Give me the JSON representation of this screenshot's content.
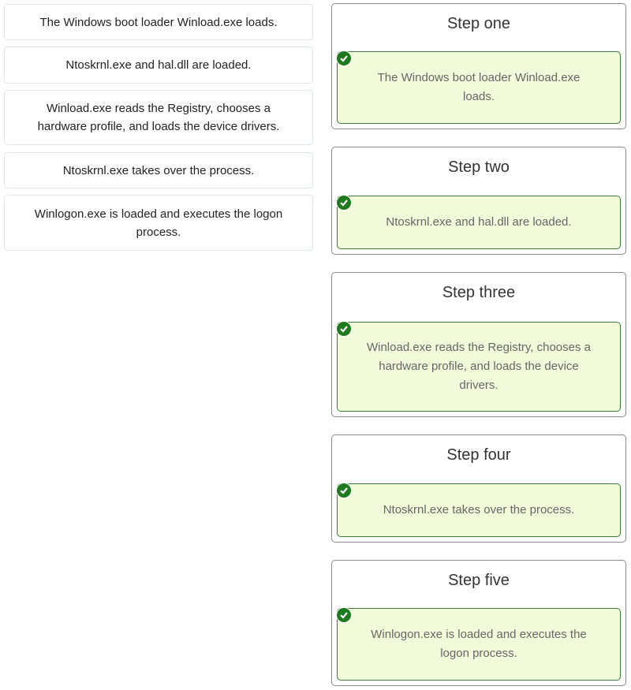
{
  "source_items": [
    {
      "label": "The Windows boot loader Winload.exe loads."
    },
    {
      "label": "Ntoskrnl.exe and hal.dll are loaded."
    },
    {
      "label": "Winload.exe reads the Registry, chooses a hardware profile, and loads the device drivers."
    },
    {
      "label": "Ntoskrnl.exe takes over the process."
    },
    {
      "label": "Winlogon.exe is loaded and executes the logon process."
    }
  ],
  "targets": [
    {
      "title": "Step one",
      "answer": "The Windows boot loader Winload.exe loads.",
      "status_icon": "check-circle-icon"
    },
    {
      "title": "Step two",
      "answer": "Ntoskrnl.exe and hal.dll are loaded.",
      "status_icon": "check-circle-icon"
    },
    {
      "title": "Step three",
      "answer": "Winload.exe reads the Registry, chooses a hardware profile, and loads the device drivers.",
      "status_icon": "check-circle-icon"
    },
    {
      "title": "Step four",
      "answer": "Ntoskrnl.exe takes over the process.",
      "status_icon": "check-circle-icon"
    },
    {
      "title": "Step five",
      "answer": "Winlogon.exe is loaded and executes the logon process.",
      "status_icon": "check-circle-icon"
    }
  ],
  "colors": {
    "correct_bg": "#f2fbd9",
    "correct_border": "#3a7a3a",
    "check_icon": "#1f7a1f"
  }
}
